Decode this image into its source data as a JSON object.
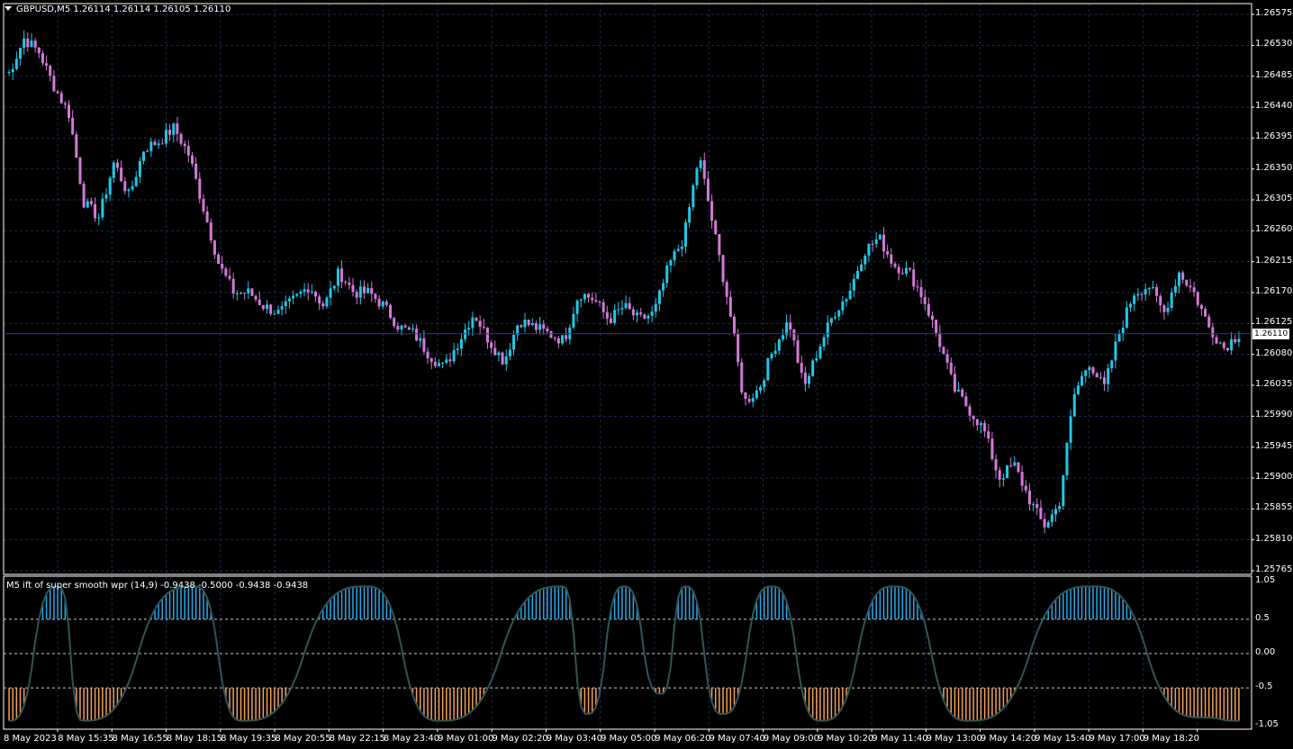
{
  "main": {
    "symbol_line": "GBPUSD,M5  1.26114 1.26114 1.26105 1.26110",
    "current_price": "1.26110",
    "price_labels": [
      "1.26575",
      "1.26530",
      "1.26485",
      "1.26440",
      "1.26395",
      "1.26350",
      "1.26305",
      "1.26260",
      "1.26215",
      "1.26170",
      "1.26125",
      "1.26080",
      "1.26035",
      "1.25990",
      "1.25945",
      "1.25900",
      "1.25855",
      "1.25810",
      "1.25765"
    ]
  },
  "indicator": {
    "title": "M5 ift of super smooth wpr (14,9) -0.9438 -0.5000 -0.9438 -0.9438",
    "level_labels": [
      "1.05",
      "0.5",
      "0.00",
      "-0.5",
      "-1.05"
    ]
  },
  "time_labels": [
    "8 May 2023",
    "8 May 15:35",
    "8 May 16:55",
    "8 May 18:15",
    "8 May 19:35",
    "8 May 20:55",
    "8 May 22:15",
    "8 May 23:40",
    "9 May 01:00",
    "9 May 02:20",
    "9 May 03:40",
    "9 May 05:00",
    "9 May 06:20",
    "9 May 07:40",
    "9 May 09:00",
    "9 May 10:20",
    "9 May 11:40",
    "9 May 13:00",
    "9 May 14:20",
    "9 May 15:40",
    "9 May 17:00",
    "9 May 18:20"
  ],
  "colors": {
    "background": "#000000",
    "grid": "#1c2a55",
    "bull_candle": "#1fc8e6",
    "bear_candle": "#d27ad6",
    "indicator_up": "#2aa8e8",
    "indicator_down": "#f0a05a",
    "indicator_mid": "#2f5555"
  },
  "chart_data": [
    {
      "type": "candlestick",
      "title": "GBPUSD,M5",
      "ylim": [
        1.25765,
        1.26575
      ],
      "x": [
        "8 May 2023",
        "8 May 15:35",
        "8 May 16:55",
        "8 May 18:15",
        "8 May 19:35",
        "8 May 20:55",
        "8 May 22:15",
        "8 May 23:40",
        "9 May 01:00",
        "9 May 02:20",
        "9 May 03:40",
        "9 May 05:00",
        "9 May 06:20",
        "9 May 07:40",
        "9 May 09:00",
        "9 May 10:20",
        "9 May 11:40",
        "9 May 13:00",
        "9 May 14:20",
        "9 May 15:40",
        "9 May 17:00",
        "9 May 18:20"
      ],
      "close_path": [
        1.2649,
        1.2654,
        1.2652,
        1.2647,
        1.2643,
        1.263,
        1.2628,
        1.2636,
        1.2631,
        1.2638,
        1.2639,
        1.2641,
        1.2637,
        1.2629,
        1.2621,
        1.2617,
        1.2617,
        1.2615,
        1.2614,
        1.2616,
        1.2618,
        1.2615,
        1.262,
        1.2617,
        1.2617,
        1.2615,
        1.2612,
        1.2611,
        1.2608,
        1.2606,
        1.261,
        1.2614,
        1.261,
        1.2607,
        1.2613,
        1.2612,
        1.2611,
        1.261,
        1.2617,
        1.2616,
        1.2613,
        1.2615,
        1.2613,
        1.2614,
        1.2621,
        1.2625,
        1.2637,
        1.2626,
        1.2615,
        1.2601,
        1.2603,
        1.2609,
        1.2613,
        1.2603,
        1.2609,
        1.2614,
        1.2617,
        1.2623,
        1.2625,
        1.2621,
        1.262,
        1.2616,
        1.261,
        1.2603,
        1.26,
        1.2597,
        1.259,
        1.2592,
        1.2587,
        1.2583,
        1.2586,
        1.2602,
        1.2607,
        1.2603,
        1.2611,
        1.2617,
        1.2618,
        1.2614,
        1.262,
        1.2617,
        1.2612,
        1.2609,
        1.2611
      ],
      "last": 1.2611
    },
    {
      "type": "histogram",
      "title": "M5 ift of super smooth wpr (14,9)",
      "ylim": [
        -1.05,
        1.05
      ],
      "levels": [
        0.5,
        0.0,
        -0.5
      ],
      "values_last": [
        -0.9438,
        -0.5,
        -0.9438,
        -0.9438
      ]
    }
  ]
}
